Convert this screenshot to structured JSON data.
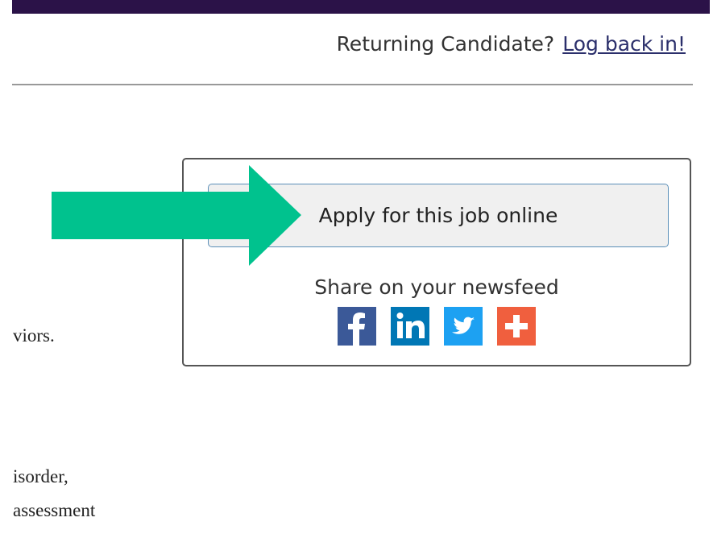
{
  "header": {
    "returning_text": "Returning Candidate?",
    "login_link": "Log back in!"
  },
  "body_fragments": [
    "viors.",
    "isorder,",
    "assessment"
  ],
  "apply_panel": {
    "apply_button_label": "Apply for this job online",
    "share_label": "Share on your newsfeed",
    "share_icons": [
      {
        "icon": "facebook-icon",
        "color": "#3b5998"
      },
      {
        "icon": "linkedin-icon",
        "color": "#0077b5"
      },
      {
        "icon": "twitter-icon",
        "color": "#1da1f2"
      },
      {
        "icon": "addthis-plus-icon",
        "color": "#f05f3e"
      }
    ]
  },
  "colors": {
    "top_bar": "#2b1248",
    "arrow": "#00c28e"
  }
}
